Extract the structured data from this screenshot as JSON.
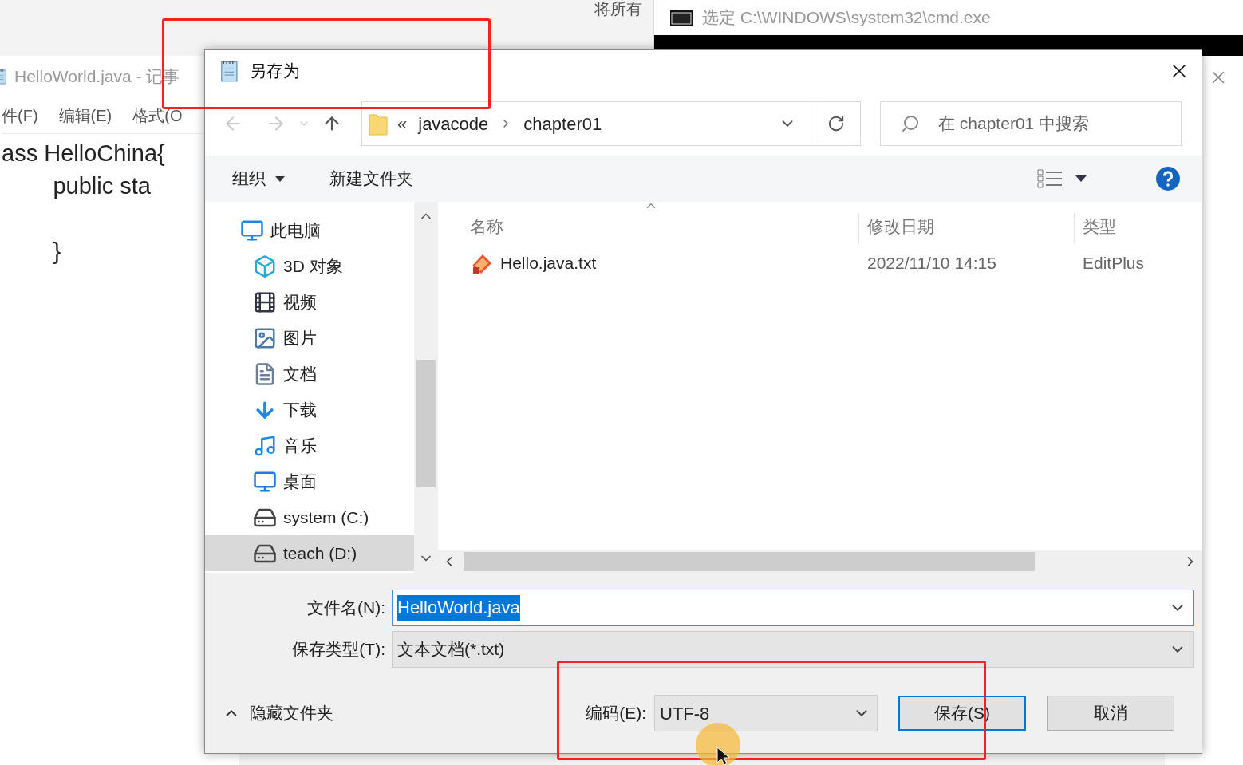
{
  "ribbon": {
    "labels": [
      "将所有"
    ]
  },
  "cmd_window": {
    "title": "选定 C:\\WINDOWS\\system32\\cmd.exe"
  },
  "notepad": {
    "title": "HelloWorld.java - 记事",
    "menu": [
      "件(F)",
      "编辑(E)",
      "格式(O"
    ],
    "code_lines": [
      {
        "text": "ass HelloChina{",
        "blank_before": false
      },
      {
        "text": "\t\tpublic sta",
        "blank_before": false
      },
      {
        "text": "\t\t}",
        "blank_before": true
      }
    ]
  },
  "dialog": {
    "title": "另存为",
    "address": {
      "overflow": "«",
      "crumbs": [
        "javacode",
        "chapter01"
      ]
    },
    "search": {
      "placeholder": "在 chapter01 中搜索"
    },
    "toolbar": [
      {
        "label": "组织",
        "kind": "menu"
      },
      {
        "label": "新建文件夹",
        "kind": "button"
      }
    ],
    "nav": [
      {
        "label": "此电脑",
        "kind": "pc",
        "selected": false,
        "children": [
          {
            "label": "3D 对象",
            "kind": "cube",
            "selected": false
          },
          {
            "label": "视频",
            "kind": "film",
            "selected": false
          },
          {
            "label": "图片",
            "kind": "image",
            "selected": false
          },
          {
            "label": "文档",
            "kind": "doc",
            "selected": false
          },
          {
            "label": "下载",
            "kind": "download",
            "selected": false
          },
          {
            "label": "音乐",
            "kind": "music",
            "selected": false
          },
          {
            "label": "桌面",
            "kind": "desktop",
            "selected": false
          },
          {
            "label": "system (C:)",
            "kind": "sysdrive",
            "selected": false
          },
          {
            "label": "teach (D:)",
            "kind": "drive",
            "selected": true
          }
        ]
      }
    ],
    "columns": [
      "名称",
      "修改日期",
      "类型"
    ],
    "files": [
      {
        "name": "Hello.java.txt",
        "date": "2022/11/10 14:15",
        "type": "EditPlus",
        "selected": false
      }
    ],
    "filename": {
      "label": "文件名(N):",
      "value": "HelloWorld.java"
    },
    "save_type": {
      "label": "保存类型(T):",
      "value": "文本文档(*.txt)"
    },
    "hide_folders": {
      "label": "隐藏文件夹",
      "expanded": true
    },
    "encoding": {
      "label": "编码(E):",
      "value": "UTF-8"
    },
    "buttons": [
      {
        "label": "保存(S)",
        "default": true
      },
      {
        "label": "取消",
        "default": false
      }
    ]
  }
}
